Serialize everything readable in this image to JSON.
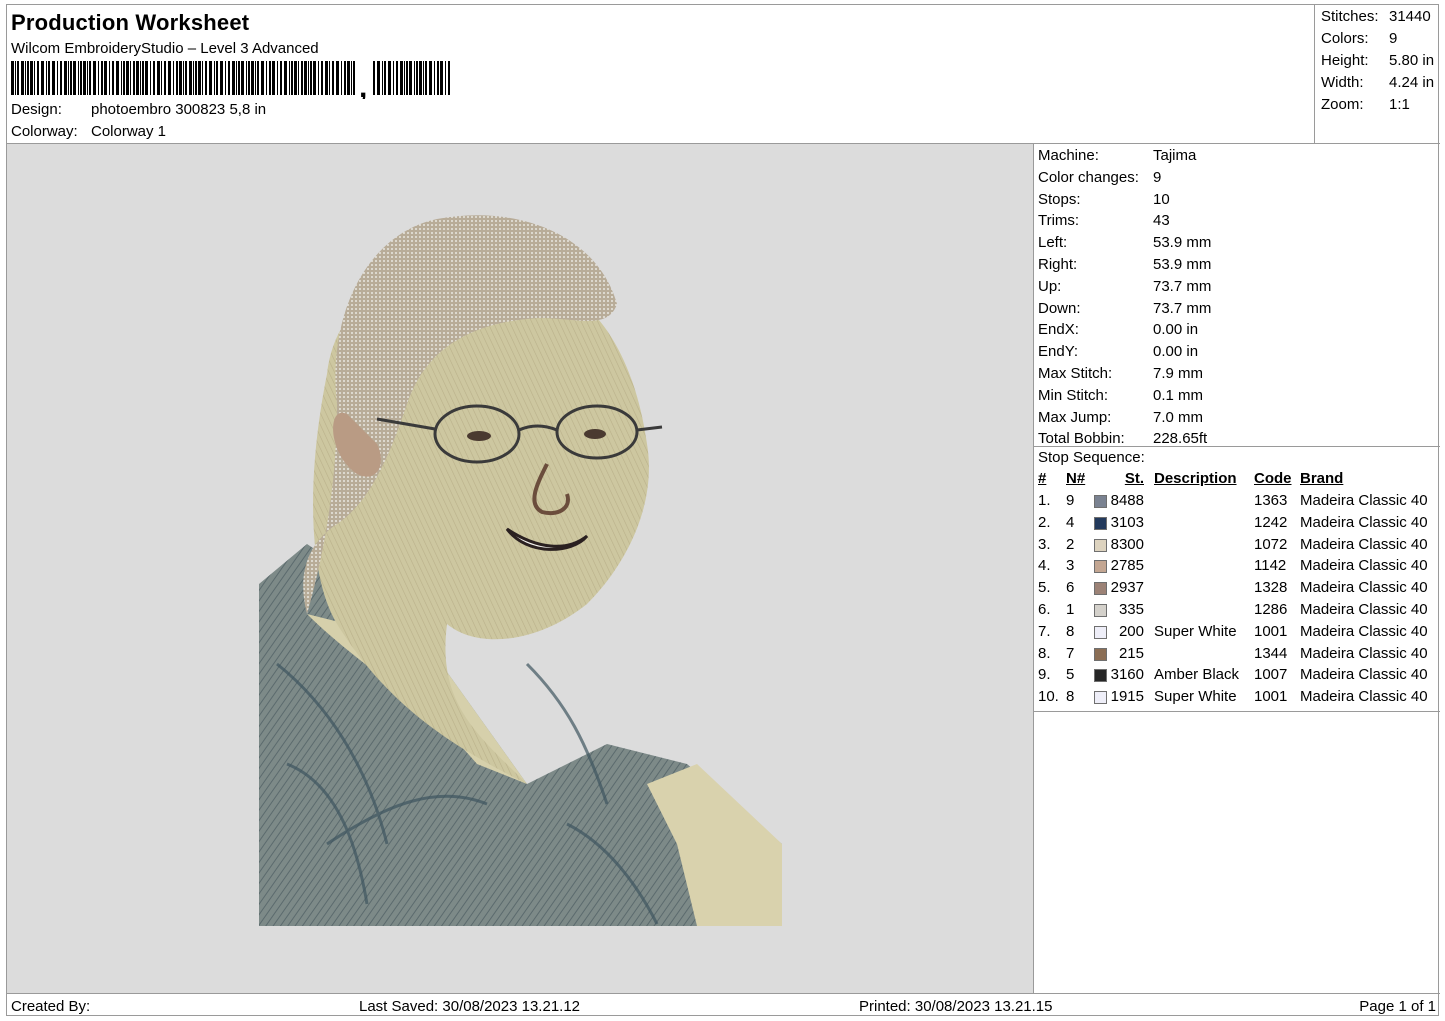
{
  "header": {
    "title": "Production Worksheet",
    "subtitle": "Wilcom EmbroideryStudio – Level 3 Advanced",
    "design_label": "Design:",
    "design_value": "photoembro 300823 5,8 in",
    "colorway_label": "Colorway:",
    "colorway_value": "Colorway 1",
    "barcode_icon": "barcode-icon"
  },
  "summary": {
    "stitches_label": "Stitches:",
    "stitches": "31440",
    "colors_label": "Colors:",
    "colors": "9",
    "height_label": "Height:",
    "height": "5.80 in",
    "width_label": "Width:",
    "width": "4.24 in",
    "zoom_label": "Zoom:",
    "zoom": "1:1"
  },
  "machine": {
    "rows": [
      {
        "label": "Machine:",
        "value": "Tajima"
      },
      {
        "label": "Color changes:",
        "value": "9"
      },
      {
        "label": "Stops:",
        "value": "10"
      },
      {
        "label": "Trims:",
        "value": "43"
      },
      {
        "label": "Left:",
        "value": "53.9 mm"
      },
      {
        "label": "Right:",
        "value": "53.9 mm"
      },
      {
        "label": "Up:",
        "value": "73.7 mm"
      },
      {
        "label": "Down:",
        "value": "73.7 mm"
      },
      {
        "label": "EndX:",
        "value": "0.00 in"
      },
      {
        "label": "EndY:",
        "value": "0.00 in"
      },
      {
        "label": "Max Stitch:",
        "value": "7.9 mm"
      },
      {
        "label": "Min Stitch:",
        "value": "0.1 mm"
      },
      {
        "label": "Max Jump:",
        "value": "7.0 mm"
      },
      {
        "label": "Total Bobbin:",
        "value": "228.65ft"
      }
    ]
  },
  "stop_sequence": {
    "title": "Stop Sequence:",
    "headers": {
      "idx": "#",
      "n": "N#",
      "st": "St.",
      "desc": "Description",
      "code": "Code",
      "brand": "Brand"
    },
    "rows": [
      {
        "idx": "1.",
        "n": "9",
        "color": "#7a8291",
        "st": "8488",
        "desc": "",
        "code": "1363",
        "brand": "Madeira Classic 40"
      },
      {
        "idx": "2.",
        "n": "4",
        "color": "#233a5c",
        "st": "3103",
        "desc": "",
        "code": "1242",
        "brand": "Madeira Classic 40"
      },
      {
        "idx": "3.",
        "n": "2",
        "color": "#ddd3bf",
        "st": "8300",
        "desc": "",
        "code": "1072",
        "brand": "Madeira Classic 40"
      },
      {
        "idx": "4.",
        "n": "3",
        "color": "#c3a692",
        "st": "2785",
        "desc": "",
        "code": "1142",
        "brand": "Madeira Classic 40"
      },
      {
        "idx": "5.",
        "n": "6",
        "color": "#9c8276",
        "st": "2937",
        "desc": "",
        "code": "1328",
        "brand": "Madeira Classic 40"
      },
      {
        "idx": "6.",
        "n": "1",
        "color": "#d4d1cb",
        "st": "335",
        "desc": "",
        "code": "1286",
        "brand": "Madeira Classic 40"
      },
      {
        "idx": "7.",
        "n": "8",
        "color": "#eeeef8",
        "st": "200",
        "desc": "Super White",
        "code": "1001",
        "brand": "Madeira Classic 40"
      },
      {
        "idx": "8.",
        "n": "7",
        "color": "#8b6e55",
        "st": "215",
        "desc": "",
        "code": "1344",
        "brand": "Madeira Classic 40"
      },
      {
        "idx": "9.",
        "n": "5",
        "color": "#262626",
        "st": "3160",
        "desc": "Amber Black",
        "code": "1007",
        "brand": "Madeira Classic 40"
      },
      {
        "idx": "10.",
        "n": "8",
        "color": "#eeeef8",
        "st": "1915",
        "desc": "Super White",
        "code": "1001",
        "brand": "Madeira Classic 40"
      }
    ]
  },
  "footer": {
    "created_by": "Created By:",
    "last_saved": "Last Saved: 30/08/2023 13.21.12",
    "printed": "Printed: 30/08/2023 13.21.15",
    "page": "Page 1 of 1"
  },
  "design_preview": {
    "background": "#dcdcdc",
    "image_icon": "embroidery-portrait-image"
  }
}
